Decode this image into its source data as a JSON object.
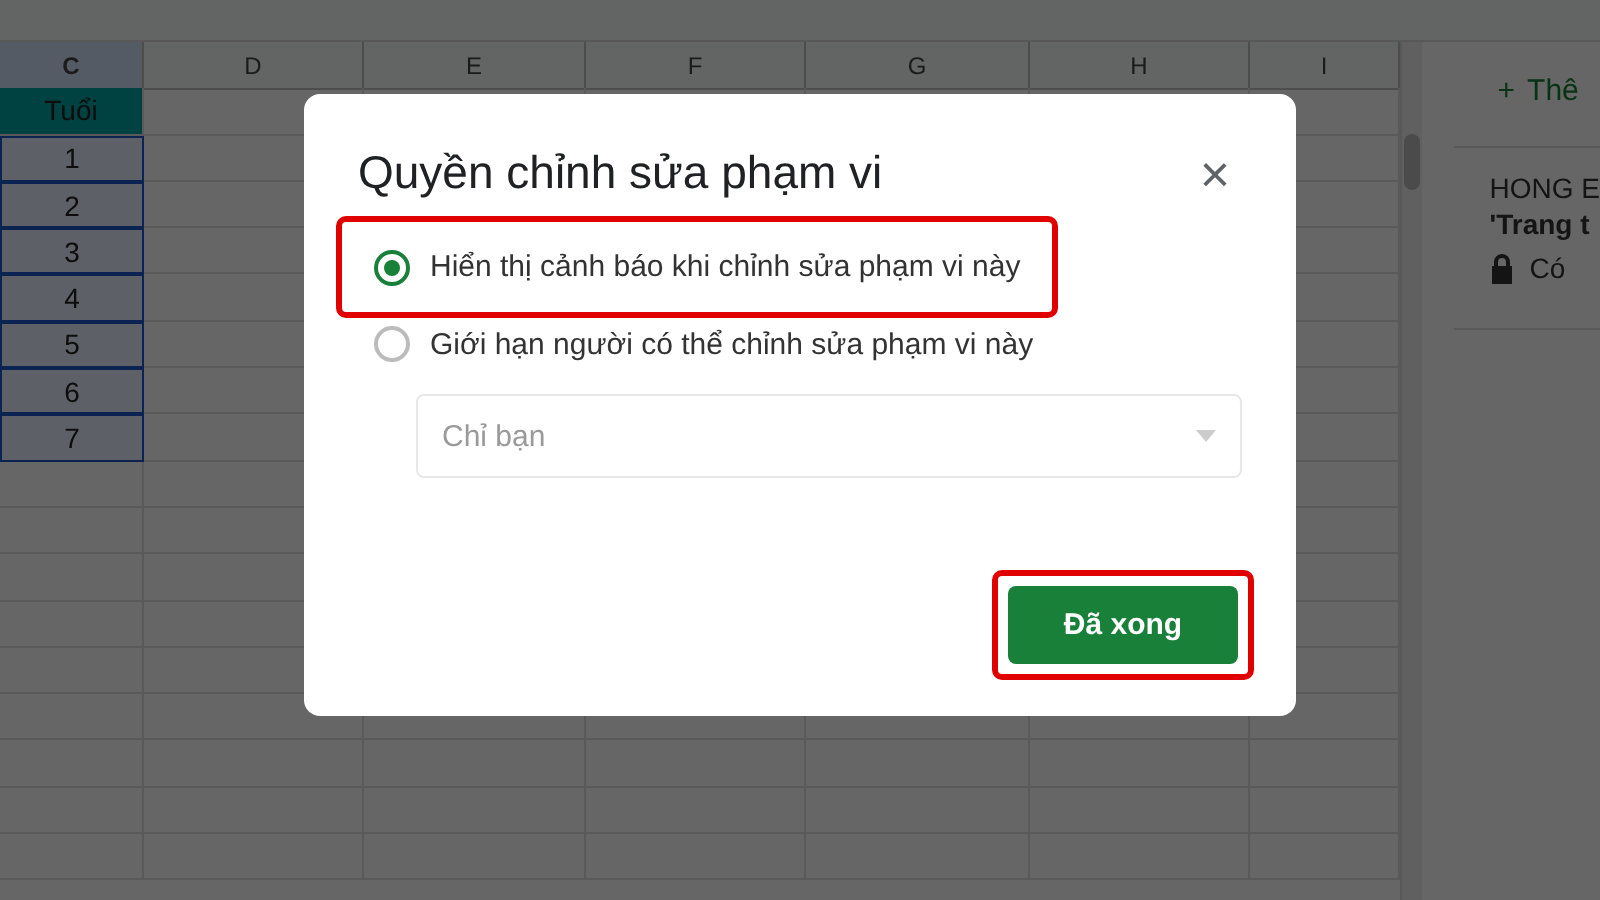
{
  "sheet": {
    "columns": [
      {
        "label": "C",
        "selected": true
      },
      {
        "label": "D",
        "selected": false
      },
      {
        "label": "E",
        "selected": false
      },
      {
        "label": "F",
        "selected": false
      },
      {
        "label": "G",
        "selected": false
      },
      {
        "label": "H",
        "selected": false
      },
      {
        "label": "I",
        "selected": false
      }
    ],
    "column_c": [
      {
        "text": "Tuổi",
        "kind": "header",
        "selected": false
      },
      {
        "text": "1",
        "kind": "value",
        "selected": true
      },
      {
        "text": "2",
        "kind": "value",
        "selected": true
      },
      {
        "text": "3",
        "kind": "value",
        "selected": true
      },
      {
        "text": "4",
        "kind": "value",
        "selected": true
      },
      {
        "text": "5",
        "kind": "value",
        "selected": true
      },
      {
        "text": "6",
        "kind": "value",
        "selected": true
      },
      {
        "text": "7",
        "kind": "value",
        "selected": true
      }
    ]
  },
  "side_panel": {
    "add_button": {
      "icon": "+",
      "label": "Thê"
    },
    "range": {
      "owner": "HONG E",
      "sheet": "'Trang t",
      "permission": "Có"
    }
  },
  "dialog": {
    "title": "Quyền chỉnh sửa phạm vi",
    "close": "×",
    "options": [
      {
        "label": "Hiển thị cảnh báo khi chỉnh sửa phạm vi này",
        "selected": true,
        "highlighted": true
      },
      {
        "label": "Giới hạn người có thể chỉnh sửa phạm vi này",
        "selected": false,
        "highlighted": false
      }
    ],
    "select": {
      "placeholder": "Chỉ bạn",
      "disabled": true
    },
    "done_button": {
      "label": "Đã xong",
      "highlighted": true
    }
  }
}
